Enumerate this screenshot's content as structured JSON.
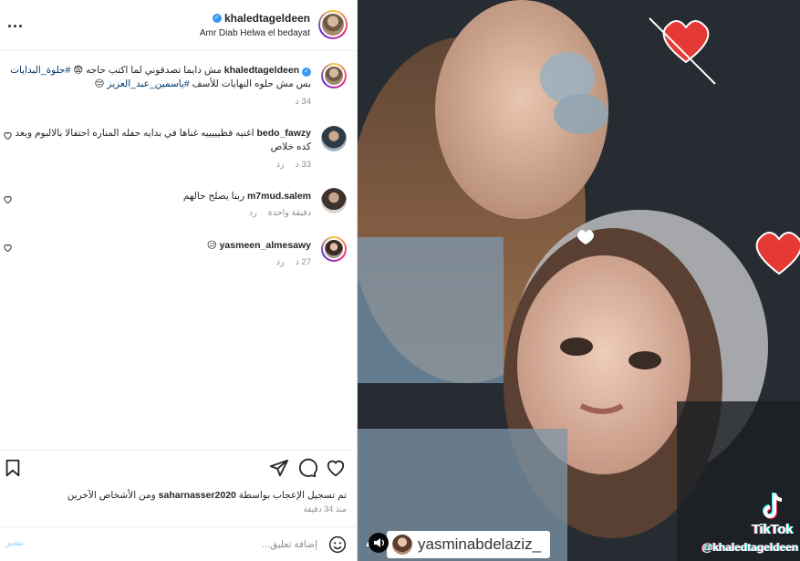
{
  "header": {
    "username": "khaledtageldeen",
    "subtitle": "Amr Diab Helwa el bedayat",
    "more_label": "..."
  },
  "caption": {
    "username": "khaledtageldeen",
    "text_a": " مش دايما تصدقوني لما اكتب حاجه 😨 ",
    "hashtag1": "#حلوة_البدايات",
    "text_b": " بس مش حلوه النهايات للأسف ",
    "hashtag2": "#ياسمين_عبد_العزيز",
    "text_c": " 😔",
    "time": "34 د"
  },
  "comments": [
    {
      "username": "bedo_fawzy",
      "text": " اغنيه فظيييييه غناها في بدايه حفله المناره احتفالا بالالبوم وبعد كده خلاص",
      "time": "33 د",
      "reply": "رد"
    },
    {
      "username": "m7mud.salem",
      "text": " ربنا يصلح حالهم",
      "time": "دقيقة واحدة",
      "reply": "رد"
    },
    {
      "username": "yasmeen_almesawy",
      "text": " 😥",
      "time": "27 د",
      "reply": "رد"
    }
  ],
  "actions": {
    "likes_prefix": "تم تسجيل الإعجاب بواسطة ",
    "likes_user": "saharnasser2020",
    "likes_suffix": " ومن الأشخاص الآخرين",
    "time_ago": "منذ 34 دقيقة"
  },
  "comment_box": {
    "placeholder": "إضافة تعليق...",
    "post_label": "نشر"
  },
  "video": {
    "tiktok_label": "TikTok",
    "tiktok_handle": "@khaledtageldeen",
    "tag_username": "yasminabdelaziz_"
  },
  "colors": {
    "verified": "#3897f0",
    "link": "#00376b",
    "muted": "#8e8e8e"
  }
}
